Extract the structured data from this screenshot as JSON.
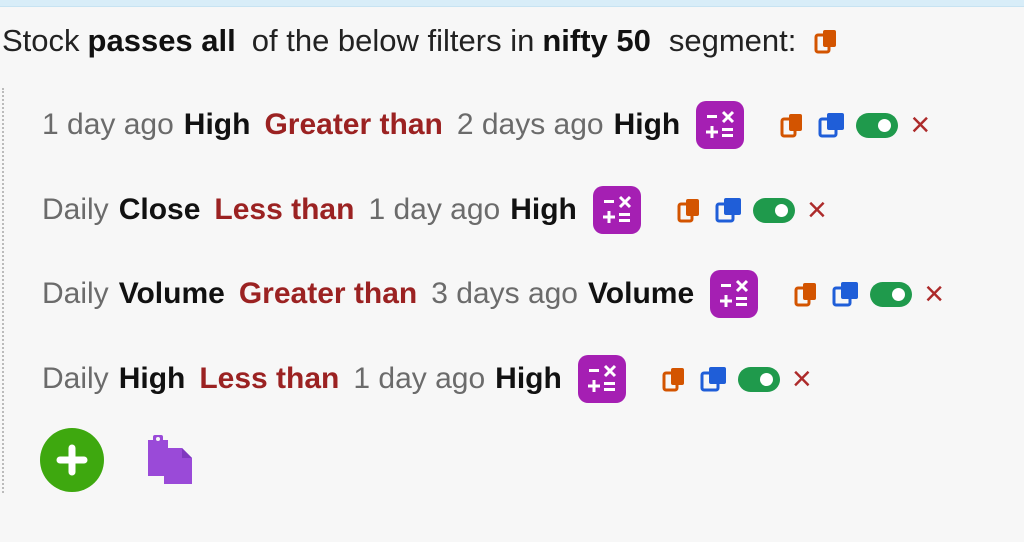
{
  "header": {
    "prefix": "Stock",
    "emphasis": "passes all",
    "middle": "of the below filters in",
    "segment": "nifty 50",
    "suffix": "segment:",
    "icon": "copy-icon"
  },
  "rules": [
    {
      "left_timeframe": "1 day ago",
      "left_metric": "High",
      "operator": "Greater than",
      "right_timeframe": "2 days ago",
      "right_metric": "High"
    },
    {
      "left_timeframe": "Daily",
      "left_metric": "Close",
      "operator": "Less than",
      "right_timeframe": "1 day ago",
      "right_metric": "High"
    },
    {
      "left_timeframe": "Daily",
      "left_metric": "Volume",
      "operator": "Greater than",
      "right_timeframe": "3 days ago",
      "right_metric": "Volume"
    },
    {
      "left_timeframe": "Daily",
      "left_metric": "High",
      "operator": "Less than",
      "right_timeframe": "1 day ago",
      "right_metric": "High"
    }
  ],
  "actions": {
    "copy_icon": "copy-icon",
    "duplicate_icon": "duplicate-icon",
    "toggle_icon": "toggle-icon",
    "delete_label": "×",
    "calculator_icon": "calculator-icon",
    "add_icon": "add-icon",
    "paste_icon": "paste-icon"
  },
  "colors": {
    "operator": "#9b2222",
    "calculator": "#a51fb3",
    "copy": "#d35400",
    "duplicate": "#1f5ed8",
    "toggle": "#1f9a4c",
    "delete": "#ad2b2b",
    "add": "#3ea80f",
    "paste": "#9a4ad8"
  }
}
